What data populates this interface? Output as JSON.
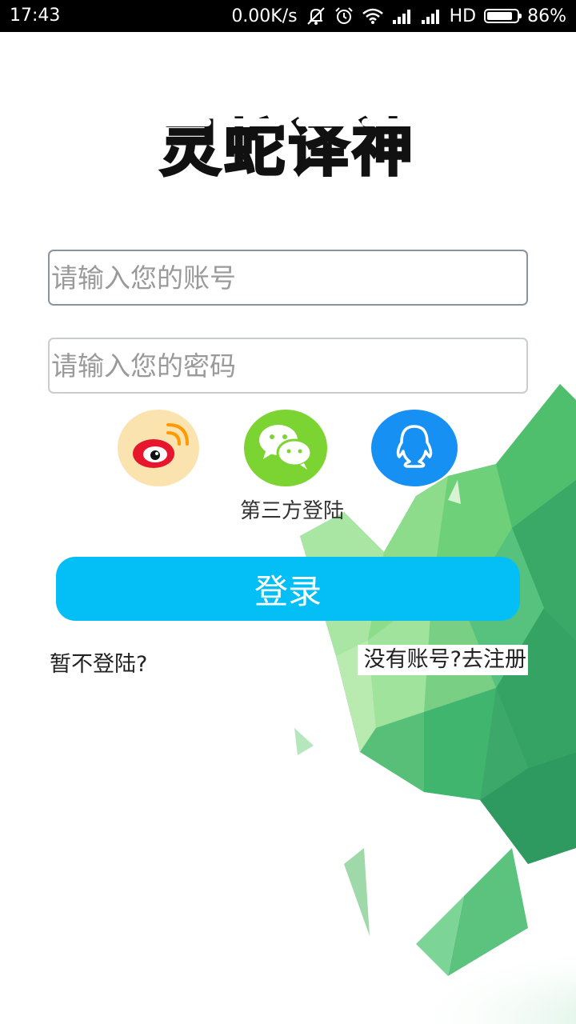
{
  "status_bar": {
    "time": "17:43",
    "network_speed": "0.00K/s",
    "network_type": "HD",
    "battery_percent": "86%",
    "battery_level": 0.86,
    "icons": [
      "mute-icon",
      "alarm-icon",
      "wifi-icon",
      "signal-icon",
      "signal-icon",
      "battery-icon"
    ]
  },
  "logo": {
    "text": "灵蛇译神"
  },
  "login_form": {
    "account_placeholder": "请输入您的账号",
    "account_value": "",
    "password_placeholder": "请输入您的密码",
    "password_value": ""
  },
  "social_login": {
    "label": "第三方登陆",
    "providers": [
      {
        "name": "weibo",
        "icon": "weibo-icon",
        "color": "#fbe3b0"
      },
      {
        "name": "wechat",
        "icon": "wechat-icon",
        "color": "#7bd431"
      },
      {
        "name": "qq",
        "icon": "qq-icon",
        "color": "#1690f2"
      }
    ]
  },
  "buttons": {
    "login_label": "登录"
  },
  "links": {
    "skip_login": "暂不登陆?",
    "register": "没有账号?去注册"
  },
  "colors": {
    "accent": "#04bff6",
    "status_bar_bg": "#000000",
    "background_art": "#3fbf72"
  }
}
